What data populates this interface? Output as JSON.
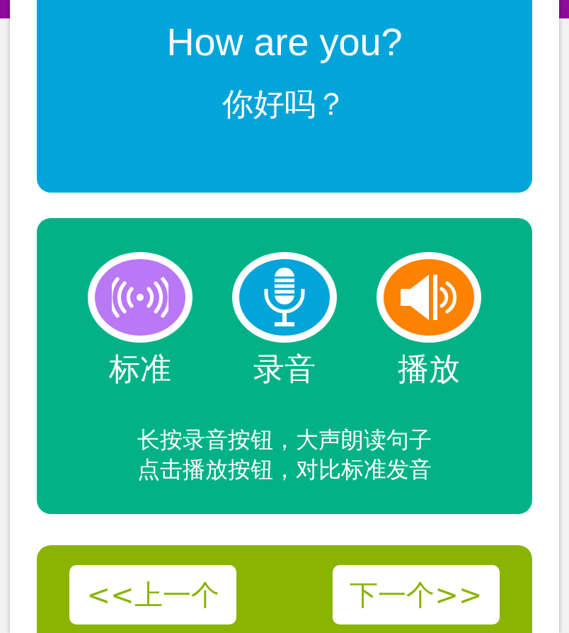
{
  "sentence": {
    "english": "How are you?",
    "chinese": "你好吗？"
  },
  "actions": [
    {
      "kind": "standard",
      "label": "标准",
      "color": "#b978f5"
    },
    {
      "kind": "record",
      "label": "录音",
      "color": "#02a5da"
    },
    {
      "kind": "play",
      "label": "播放",
      "color": "#fd8200"
    }
  ],
  "instructions": [
    "长按录音按钮，大声朗读句子",
    "点击播放按钮，对比标准发音"
  ],
  "navigation": [
    "<<上一个",
    "下一个>>"
  ]
}
